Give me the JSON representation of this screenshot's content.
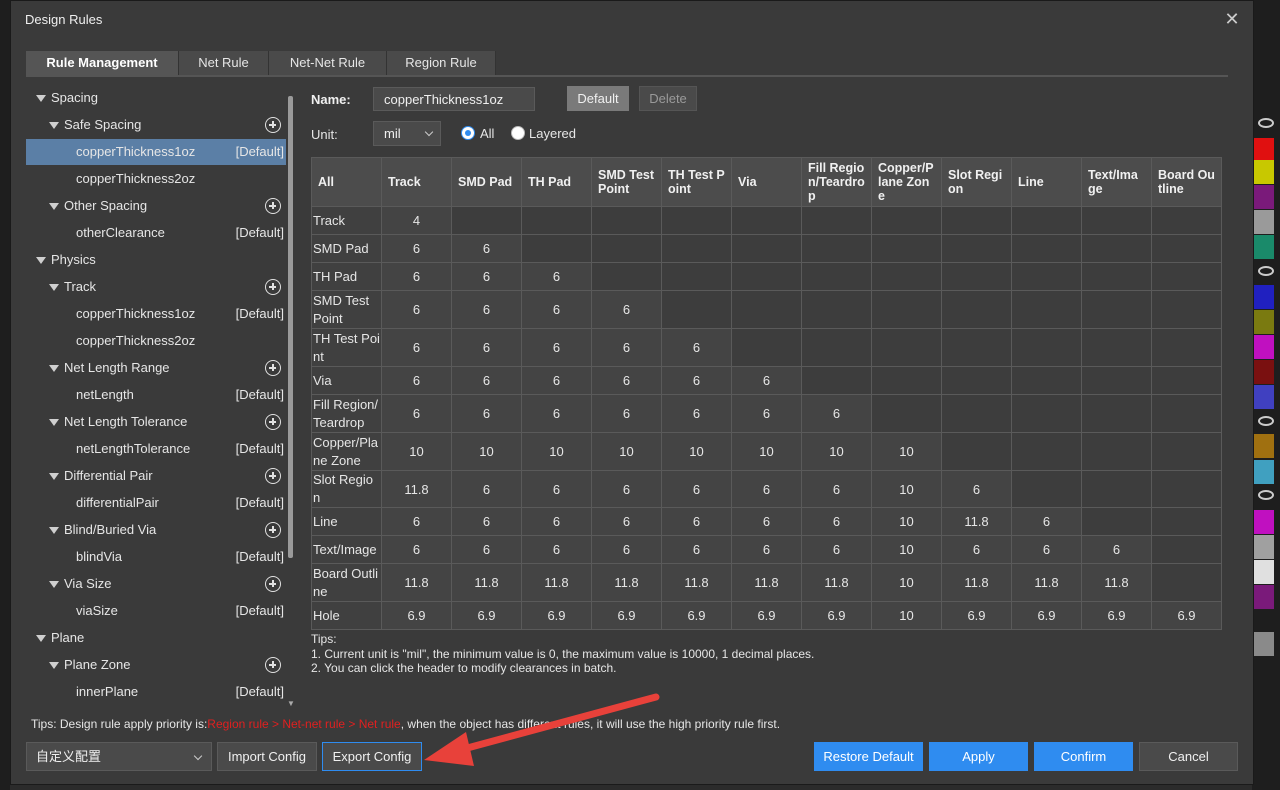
{
  "dialog": {
    "title": "Design Rules",
    "close_glyph": "✕"
  },
  "tabs": [
    "Rule Management",
    "Net Rule",
    "Net-Net Rule",
    "Region Rule"
  ],
  "tree": [
    {
      "label": "Spacing",
      "level": 0,
      "caret": true
    },
    {
      "label": "Safe Spacing",
      "level": 1,
      "caret": true,
      "add": true
    },
    {
      "label": "copperThickness1oz",
      "level": 2,
      "default": "[Default]",
      "selected": true
    },
    {
      "label": "copperThickness2oz",
      "level": 2
    },
    {
      "label": "Other Spacing",
      "level": 1,
      "caret": true,
      "add": true
    },
    {
      "label": "otherClearance",
      "level": 2,
      "default": "[Default]"
    },
    {
      "label": "Physics",
      "level": 0,
      "caret": true
    },
    {
      "label": "Track",
      "level": 1,
      "caret": true,
      "add": true
    },
    {
      "label": "copperThickness1oz",
      "level": 2,
      "default": "[Default]"
    },
    {
      "label": "copperThickness2oz",
      "level": 2
    },
    {
      "label": "Net Length Range",
      "level": 1,
      "caret": true,
      "add": true
    },
    {
      "label": "netLength",
      "level": 2,
      "default": "[Default]"
    },
    {
      "label": "Net Length Tolerance",
      "level": 1,
      "caret": true,
      "add": true
    },
    {
      "label": "netLengthTolerance",
      "level": 2,
      "default": "[Default]"
    },
    {
      "label": "Differential Pair",
      "level": 1,
      "caret": true,
      "add": true
    },
    {
      "label": "differentialPair",
      "level": 2,
      "default": "[Default]"
    },
    {
      "label": "Blind/Buried Via",
      "level": 1,
      "caret": true,
      "add": true
    },
    {
      "label": "blindVia",
      "level": 2,
      "default": "[Default]"
    },
    {
      "label": "Via Size",
      "level": 1,
      "caret": true,
      "add": true
    },
    {
      "label": "viaSize",
      "level": 2,
      "default": "[Default]"
    },
    {
      "label": "Plane",
      "level": 0,
      "caret": true
    },
    {
      "label": "Plane Zone",
      "level": 1,
      "caret": true,
      "add": true
    },
    {
      "label": "innerPlane",
      "level": 2,
      "default": "[Default]"
    }
  ],
  "form": {
    "name_label": "Name:",
    "name_value": "copperThickness1oz",
    "default_button": "Default",
    "delete_button": "Delete",
    "unit_label": "Unit:",
    "unit_value": "mil",
    "radio_all": "All",
    "radio_layered": "Layered",
    "selected_radio": "All"
  },
  "matrix": {
    "corner": "All",
    "columns": [
      "Track",
      "SMD Pad",
      "TH Pad",
      "SMD Test Point",
      "TH Test Point",
      "Via",
      "Fill Region/Teardrop",
      "Copper/Plane Zone",
      "Slot Region",
      "Line",
      "Text/Image",
      "Board Outline"
    ],
    "rows": [
      {
        "label": "Track",
        "values": [
          "4"
        ]
      },
      {
        "label": "SMD Pad",
        "values": [
          "6",
          "6"
        ]
      },
      {
        "label": "TH Pad",
        "values": [
          "6",
          "6",
          "6"
        ]
      },
      {
        "label": "SMD Test Point",
        "values": [
          "6",
          "6",
          "6",
          "6"
        ]
      },
      {
        "label": "TH Test Point",
        "values": [
          "6",
          "6",
          "6",
          "6",
          "6"
        ]
      },
      {
        "label": "Via",
        "values": [
          "6",
          "6",
          "6",
          "6",
          "6",
          "6"
        ]
      },
      {
        "label": "Fill Region/Teardrop",
        "values": [
          "6",
          "6",
          "6",
          "6",
          "6",
          "6",
          "6"
        ]
      },
      {
        "label": "Copper/Plane Zone",
        "values": [
          "10",
          "10",
          "10",
          "10",
          "10",
          "10",
          "10",
          "10"
        ]
      },
      {
        "label": "Slot Region",
        "values": [
          "11.8",
          "6",
          "6",
          "6",
          "6",
          "6",
          "6",
          "10",
          "6"
        ]
      },
      {
        "label": "Line",
        "values": [
          "6",
          "6",
          "6",
          "6",
          "6",
          "6",
          "6",
          "10",
          "11.8",
          "6"
        ]
      },
      {
        "label": "Text/Image",
        "values": [
          "6",
          "6",
          "6",
          "6",
          "6",
          "6",
          "6",
          "10",
          "6",
          "6",
          "6"
        ]
      },
      {
        "label": "Board Outline",
        "values": [
          "11.8",
          "11.8",
          "11.8",
          "11.8",
          "11.8",
          "11.8",
          "11.8",
          "10",
          "11.8",
          "11.8",
          "11.8"
        ]
      },
      {
        "label": "Hole",
        "values": [
          "6.9",
          "6.9",
          "6.9",
          "6.9",
          "6.9",
          "6.9",
          "6.9",
          "10",
          "6.9",
          "6.9",
          "6.9",
          "6.9"
        ]
      }
    ]
  },
  "tips": {
    "heading": "Tips:",
    "line1": "1. Current unit is \"mil\", the minimum value is 0, the maximum value is 10000, 1 decimal places.",
    "line2": "2. You can click the header to modify clearances in batch."
  },
  "priority_tip": {
    "prefix": "Tips: Design rule apply priority is:",
    "priority": "Region rule > Net-net rule > Net rule",
    "suffix": ", when the object has different rules, it will use the high priority rule first."
  },
  "footer": {
    "config_select": "自定义配置",
    "import_button": "Import Config",
    "export_button": "Export Config",
    "restore_button": "Restore Default",
    "apply_button": "Apply",
    "confirm_button": "Confirm",
    "cancel_button": "Cancel"
  },
  "colors": {
    "accent": "#2f8cf0",
    "selected_row": "#5b7fa6",
    "priority_red": "#e02020",
    "annotation_arrow": "#e8413a"
  },
  "side_swatches": [
    "#e01010",
    "#c8c800",
    "#7a1a7a",
    "#9a9a9a",
    "#1a8a6a",
    "#2020c0",
    "#7a7a10",
    "#c010c0",
    "#7a1010",
    "#4040c0",
    "#a07010",
    "#40a0c0",
    "#c010c0",
    "#a0a0a0",
    "#e0e0e0",
    "#7a1a7a",
    "#8a8a8a"
  ]
}
